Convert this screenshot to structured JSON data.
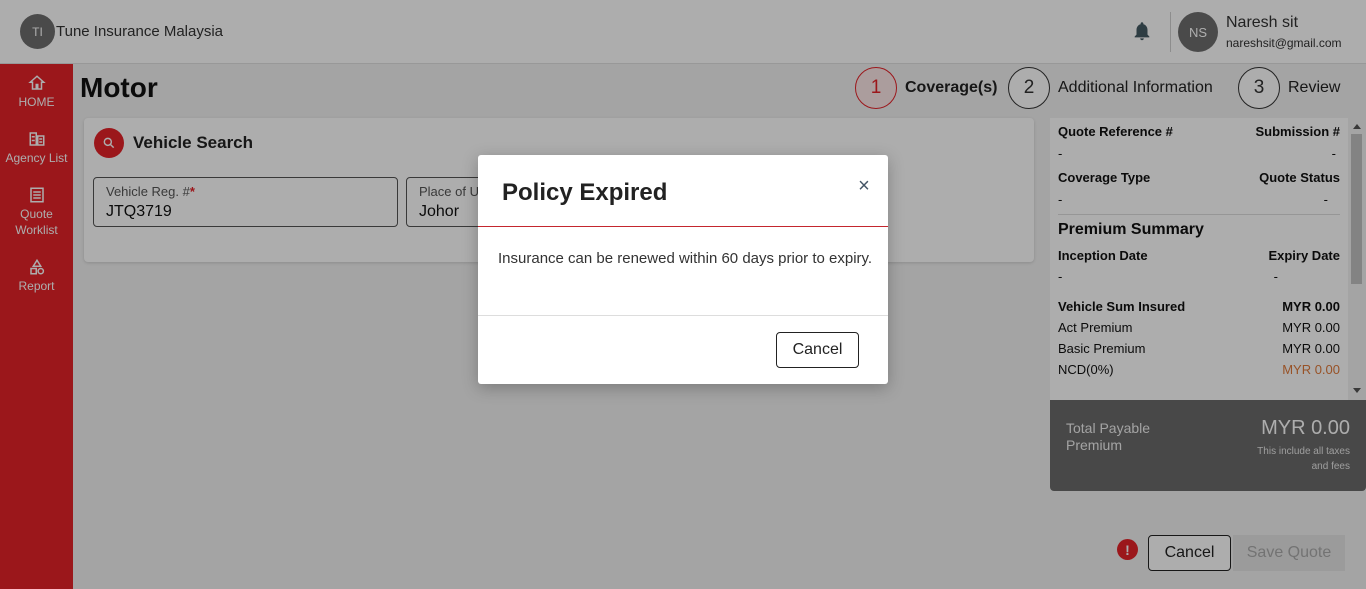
{
  "header": {
    "org_initials": "TI",
    "org_name": "Tune Insurance Malaysia",
    "user_initials": "NS",
    "user_name": "Naresh sit",
    "user_email": "nareshsit@gmail.com"
  },
  "sidebar": {
    "items": [
      {
        "label": "HOME",
        "icon": "home-icon"
      },
      {
        "label": "Agency List",
        "icon": "building-icon"
      },
      {
        "label": "Quote Worklist",
        "icon": "list-icon"
      },
      {
        "label": "Report",
        "icon": "shapes-icon"
      }
    ]
  },
  "page": {
    "title": "Motor",
    "steps": [
      {
        "number": "1",
        "label": "Coverage(s)",
        "active": true
      },
      {
        "number": "2",
        "label": "Additional Information",
        "active": false
      },
      {
        "number": "3",
        "label": "Review",
        "active": false
      }
    ]
  },
  "vehicle_search": {
    "title": "Vehicle Search",
    "reg_label": "Vehicle Reg. #",
    "reg_required_mark": "*",
    "reg_value": "JTQ3719",
    "place_label": "Place of U",
    "place_value": "Johor"
  },
  "summary": {
    "quote_ref_label": "Quote Reference #",
    "quote_ref_value": "-",
    "submission_label": "Submission #",
    "submission_value": "-",
    "coverage_type_label": "Coverage Type",
    "coverage_type_value": "-",
    "quote_status_label": "Quote Status",
    "quote_status_value": "-",
    "premium_heading": "Premium Summary",
    "inception_label": "Inception Date",
    "inception_value": "-",
    "expiry_label": "Expiry Date",
    "expiry_value": "-",
    "rows": [
      {
        "label": "Vehicle Sum Insured",
        "value": "MYR 0.00"
      },
      {
        "label": "Act Premium",
        "value": "MYR 0.00"
      },
      {
        "label": "Basic Premium",
        "value": "MYR 0.00"
      },
      {
        "label": "NCD(0%)",
        "value": "MYR 0.00"
      }
    ],
    "ncd_color": "#e07a3a"
  },
  "total": {
    "label": "Total Payable Premium",
    "amount": "MYR 0.00",
    "note": "This include all taxes and fees"
  },
  "actions": {
    "error_glyph": "!",
    "cancel_label": "Cancel",
    "save_label": "Save Quote"
  },
  "modal": {
    "title": "Policy Expired",
    "close_glyph": "×",
    "body": "Insurance can be renewed within 60 days prior to expiry.",
    "cancel_label": "Cancel"
  },
  "colors": {
    "brand_red": "#e52229",
    "summary_dark": "#6b6b6b"
  }
}
